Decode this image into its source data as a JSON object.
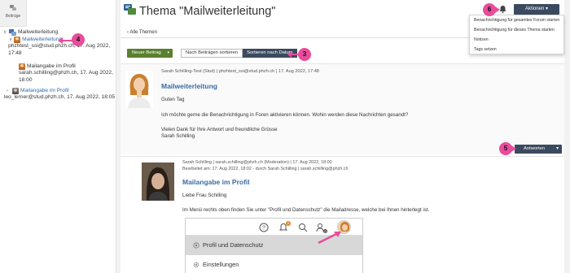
{
  "nav": {
    "tab_label": "Beiträge",
    "tree": [
      {
        "label": "Mailweiterleitung",
        "kind": "root"
      },
      {
        "label": "Mailweiterleitung",
        "kind": "link",
        "author": "phzhtest_ssi@stud.phzh.ch, 17. Aug 2022, 17:48"
      },
      {
        "label": "Mailangabe im Profil",
        "kind": "sub",
        "author": "sarah.schilling@phzh.ch, 17. Aug 2022, 18:00"
      },
      {
        "label": "Mailangabe im Profil",
        "kind": "link",
        "author": "leo_lerner@stud.phzh.ch, 17. Aug 2022, 18:05"
      }
    ]
  },
  "header": {
    "title": "Thema \"Mailweiterleitung\"",
    "actions_label": "Aktionen",
    "menu": [
      "Benachrichtigung für gesamtes Forum starten",
      "Benachrichtigung für dieses Thema starten",
      "Notizen",
      "Tags setzen"
    ]
  },
  "back_label": "Alle Themen",
  "toolbar": {
    "new_post": "Neuer Beitrag",
    "sort_by_posts": "Nach Beiträgen sortieren",
    "sort_by_date": "Sortieren nach Datum"
  },
  "badges": {
    "b3": "3",
    "b4": "4",
    "b5": "5",
    "b6": "6"
  },
  "post1": {
    "meta": "Sarah Schilling-Test (Stud) | phzhtest_ssi@stud.phzh.ch | 17. Aug 2022, 17:48",
    "title": "Mailweiterleitung",
    "greeting": "Guten Tag",
    "body": "Ich möchte gerne die Benachrichtigung in Foren aktivieren können. Wohin werden diese Nachrichten gesandt?",
    "closing": "Vielen Dank für Ihre Antwort und freundliche Grüsse",
    "signature": "Sarah Schilling",
    "reply_label": "Antworten"
  },
  "post2": {
    "meta": "Sarah Schilling | sarah.schilling@phzh.ch (Moderation) | 17. Aug 2022, 18:00",
    "edited": "Bearbeitet am: 17. Aug 2022, 18:02 - durch Sarah Schilling | sarah.schilling@phzh.ch",
    "title": "Mailangabe im Profil",
    "greeting": "Liebe Frau Schilling",
    "body": "Im Menü rechts oben finden Sie unter \"Profil und Datenschutz\" die Mailadresse, welche bei Ihnen hinterlegt ist."
  },
  "embed": {
    "notification_count": "2",
    "profile_count": "0",
    "menu_profile": "Profil und Datenschutz",
    "menu_settings": "Einstellungen"
  },
  "colors": {
    "accent_dark": "#3b4a5e",
    "accent_green": "#5a7f2e",
    "badge_pink": "#e84c9a",
    "link_blue": "#3a6aa8"
  }
}
